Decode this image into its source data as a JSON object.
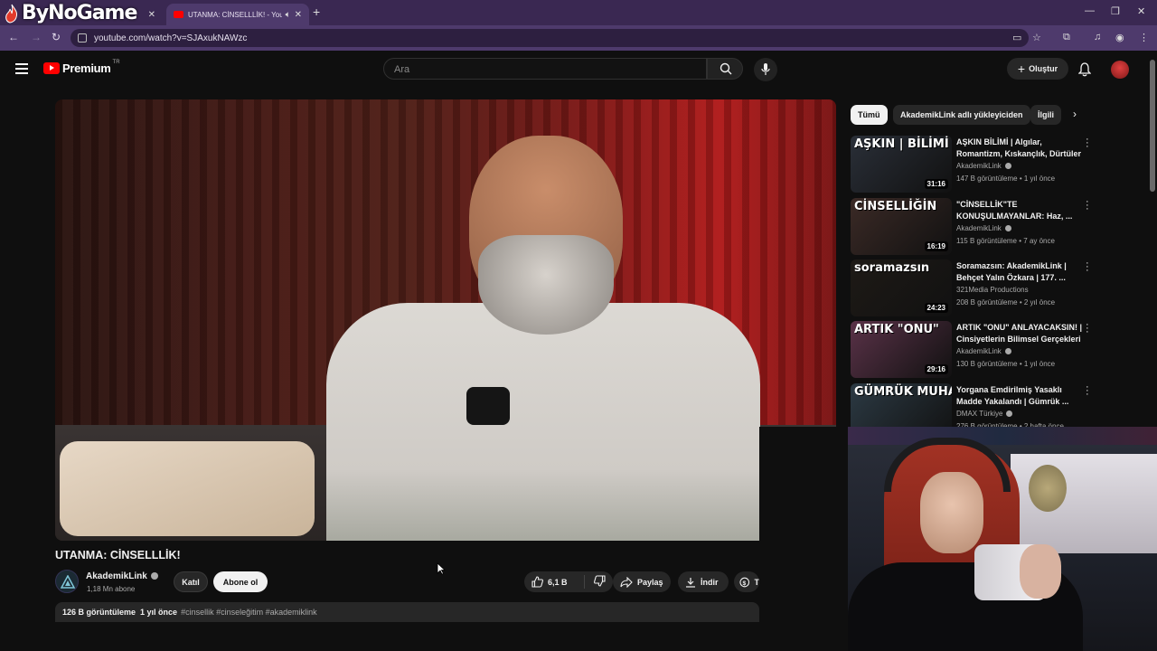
{
  "browser": {
    "brand_logo_text": "ByNoGame",
    "tabs": [
      {
        "title": "",
        "active": false
      },
      {
        "title": "UTANMA: CİNSELLLİK! - YouTube",
        "active": true
      }
    ],
    "url": "youtube.com/watch?v=SJAxukNAWzc"
  },
  "header": {
    "logo_text": "Premium",
    "logo_region": "TR",
    "search_placeholder": "Ara",
    "create_label": "Oluştur"
  },
  "video": {
    "title": "UTANMA: CİNSELLLİK!",
    "channel": "AkademikLink",
    "subscribers": "1,18 Mn abone",
    "join_label": "Katıl",
    "subscribe_label": "Abone ol",
    "likes": "6,1 B",
    "share_label": "Paylaş",
    "download_label": "İndir",
    "thanks_label": "T",
    "views": "126 B görüntüleme",
    "ago": "1 yıl önce",
    "tags": "#cinsellik #cinseleğitim #akademiklink"
  },
  "chips": [
    "Tümü",
    "AkademikLink adlı yükleyiciden",
    "İlgili"
  ],
  "recommendations": [
    {
      "thumb_text": "AŞKIN | BİLİMİ",
      "title": "AŞKIN BİLİMİ | Algılar, Romantizm, Kıskançlık, Dürtüler",
      "channel": "AkademikLink",
      "verified": true,
      "views": "147 B görüntüleme",
      "ago": "1 yıl önce",
      "duration": "31:16",
      "thumb_color": "#2a2f38"
    },
    {
      "thumb_text": "CİNSELLİĞİN",
      "title": "\"CİNSELLİK\"TE KONUŞULMAYANLAR: Haz, ...",
      "channel": "AkademikLink",
      "verified": true,
      "views": "115 B görüntüleme",
      "ago": "7 ay önce",
      "duration": "16:19",
      "thumb_color": "#3b2a26"
    },
    {
      "thumb_text": "soramazsın",
      "title": "Soramazsın: AkademikLink | Behçet Yalın Özkara | 177. ...",
      "channel": "321Media Productions",
      "verified": false,
      "views": "208 B görüntüleme",
      "ago": "2 yıl önce",
      "duration": "24:23",
      "thumb_color": "#1e1a16"
    },
    {
      "thumb_text": "ARTIK \"ONU\"",
      "title": "ARTIK \"ONU\" ANLAYACAKSIN! | Cinsiyetlerin Bilimsel Gerçekleri",
      "channel": "AkademikLink",
      "verified": true,
      "views": "130 B görüntüleme",
      "ago": "1 yıl önce",
      "duration": "29:16",
      "thumb_color": "#5a3248"
    },
    {
      "thumb_text": "GÜMRÜK MUHAFAZA",
      "title": "Yorgana Emdirilmiş Yasaklı Madde Yakalandı | Gümrük ...",
      "channel": "DMAX Türkiye",
      "verified": true,
      "views": "276 B görüntüleme",
      "ago": "2 hafta önce",
      "duration": "",
      "thumb_color": "#2c3a44"
    }
  ]
}
